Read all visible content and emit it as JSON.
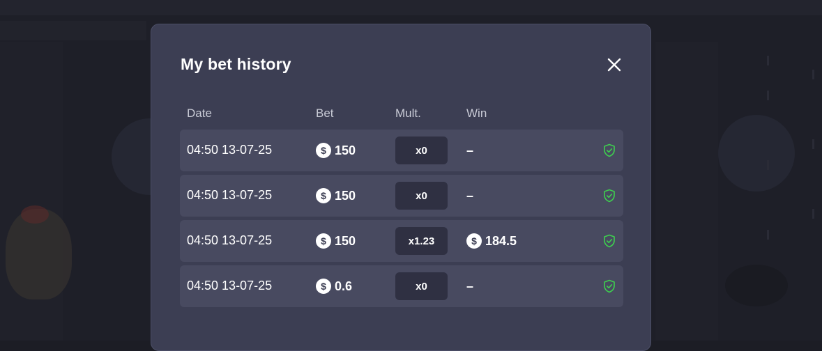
{
  "modal": {
    "title": "My bet history",
    "close_icon": "close-icon"
  },
  "columns": {
    "date": "Date",
    "bet": "Bet",
    "mult": "Mult.",
    "win": "Win"
  },
  "currency_symbol": "$",
  "rows": [
    {
      "date": "04:50 13-07-25",
      "bet": "150",
      "mult": "x0",
      "win": "–",
      "verified_icon": "shield-check-icon"
    },
    {
      "date": "04:50 13-07-25",
      "bet": "150",
      "mult": "x0",
      "win": "–",
      "verified_icon": "shield-check-icon"
    },
    {
      "date": "04:50 13-07-25",
      "bet": "150",
      "mult": "x1.23",
      "win": "184.5",
      "verified_icon": "shield-check-icon"
    },
    {
      "date": "04:50 13-07-25",
      "bet": "0.6",
      "mult": "x0",
      "win": "–",
      "verified_icon": "shield-check-icon"
    }
  ],
  "colors": {
    "modal_bg": "#3c3e53",
    "row_bg": "#484a60",
    "badge_bg": "#2f3042",
    "verified_green": "#3ecf4f"
  }
}
